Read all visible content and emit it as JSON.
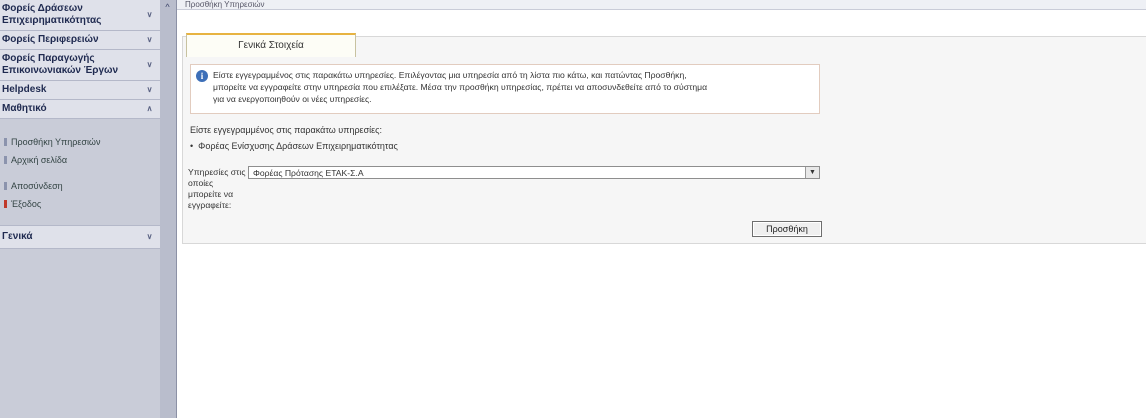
{
  "sidebar": {
    "sections": [
      {
        "label": "Φορείς Δράσεων Επιχειρηματικότητας"
      },
      {
        "label": "Φορείς Περιφερειών"
      },
      {
        "label": "Φορείς Παραγωγής Επικοινωνιακών Έργων"
      },
      {
        "label": "Helpdesk"
      },
      {
        "label": "Μαθητικό"
      }
    ],
    "links": [
      {
        "label": "Προσθήκη Υπηρεσιών"
      },
      {
        "label": "Αρχική σελίδα"
      },
      {
        "label": "Αποσύνδεση"
      },
      {
        "label": "Έξοδος"
      }
    ],
    "bottom_section": {
      "label": "Γενικά"
    }
  },
  "topbar": {
    "title": "Προσθήκη Υπηρεσιών"
  },
  "tab": {
    "label": "Γενικά Στοιχεία"
  },
  "info": {
    "line1": "Είστε εγγεγραμμένος στις παρακάτω υπηρεσίες. Επιλέγοντας μια υπηρεσία από τη λίστα πιο κάτω, και πατώντας Προσθήκη,",
    "line2": "μπορείτε να εγγραφείτε στην υπηρεσία που επιλέξατε. Μέσα την προσθήκη υπηρεσίας, πρέπει να αποσυνδεθείτε από το σύστημα",
    "line3": "για να ενεργοποιηθούν οι νέες υπηρεσίες."
  },
  "registered": {
    "heading": "Είστε εγγεγραμμένος στις παρακάτω υπηρεσίες:",
    "items": [
      "Φορέας Ενίσχυσης Δράσεων Επιχειρηματικότητας"
    ]
  },
  "service_select": {
    "label": "Υπηρεσίες στις οποίες μπορείτε να εγγραφείτε:",
    "selected": "Φορέας Πρότασης ΕΤΑΚ-Σ.Α"
  },
  "add_button": {
    "label": "Προσθήκη"
  }
}
